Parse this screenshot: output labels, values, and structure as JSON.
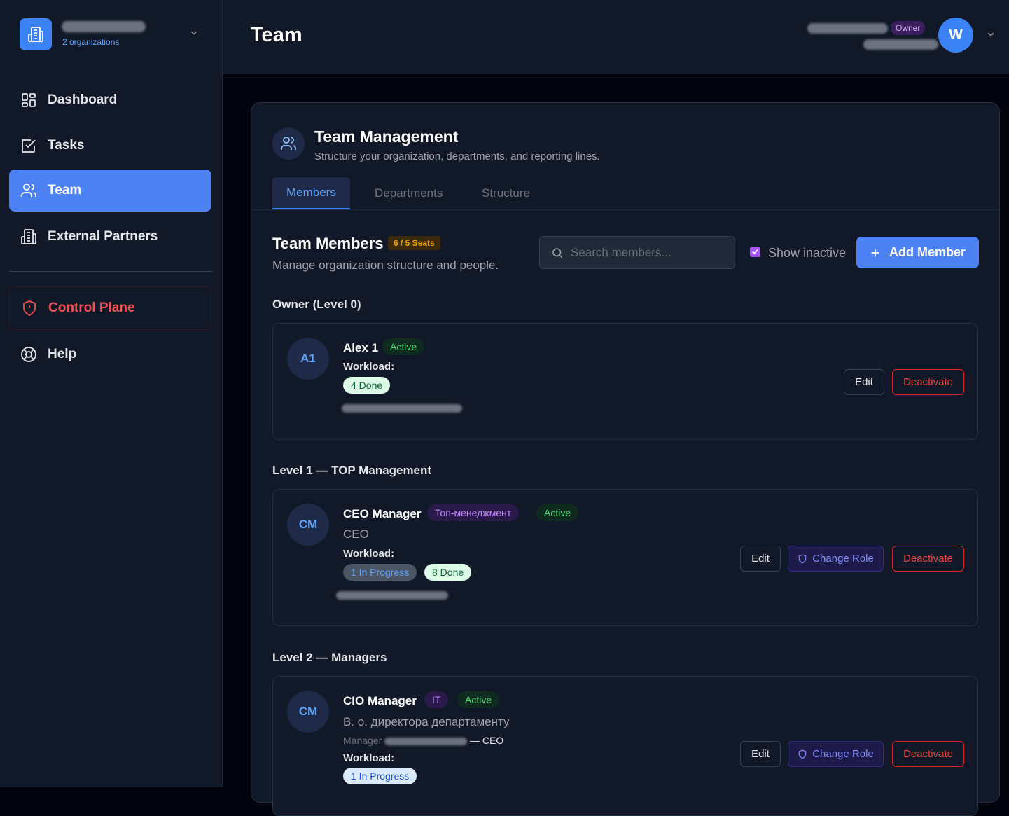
{
  "sidebar": {
    "org_count": "2 organizations",
    "items": [
      {
        "label": "Dashboard",
        "icon": "dashboard-icon"
      },
      {
        "label": "Tasks",
        "icon": "tasks-icon"
      },
      {
        "label": "Team",
        "icon": "users-icon",
        "active": true
      },
      {
        "label": "External Partners",
        "icon": "building-icon"
      }
    ],
    "control_plane": "Control Plane",
    "help": "Help"
  },
  "header": {
    "title": "Team",
    "role_badge": "Owner",
    "avatar_initial": "W"
  },
  "card": {
    "title": "Team Management",
    "subtitle": "Structure your organization, departments, and reporting lines.",
    "tabs": [
      "Members",
      "Departments",
      "Structure"
    ],
    "active_tab": "Members"
  },
  "members_section": {
    "title": "Team Members",
    "seats": "6 / 5 Seats",
    "subtitle": "Manage organization structure and people.",
    "search_placeholder": "Search members...",
    "show_inactive_label": "Show inactive",
    "show_inactive_checked": true,
    "add_member_label": "Add Member"
  },
  "levels": [
    {
      "label": "Owner (Level 0)"
    },
    {
      "label": "Level 1 — TOP Management"
    },
    {
      "label": "Level 2 — Managers"
    }
  ],
  "members": [
    {
      "initials": "A1",
      "name": "Alex 1",
      "status": "Active",
      "workload_label": "Workload:",
      "workload": [
        "4 Done"
      ],
      "edit": "Edit",
      "deactivate": "Deactivate"
    },
    {
      "initials": "CM",
      "name": "CEO Manager",
      "department": "Топ-менеджмент",
      "status": "Active",
      "title": "CEO",
      "workload_label": "Workload:",
      "workload": [
        "1 In Progress",
        "8 Done"
      ],
      "edit": "Edit",
      "change_role": "Change Role",
      "deactivate": "Deactivate"
    },
    {
      "initials": "CM",
      "name": "CIO Manager",
      "department": "IT",
      "status": "Active",
      "title": "В. о. директора департаменту",
      "manager_prefix": "Manager",
      "manager_suffix": "— CEO",
      "workload_label": "Workload:",
      "workload": [
        "1 In Progress"
      ],
      "edit": "Edit",
      "change_role": "Change Role",
      "deactivate": "Deactivate"
    }
  ],
  "colors": {
    "accent": "#4d82f5",
    "danger": "#ef4444",
    "active_green": "#4ade80",
    "background": "#02040d",
    "panel": "#111827"
  }
}
